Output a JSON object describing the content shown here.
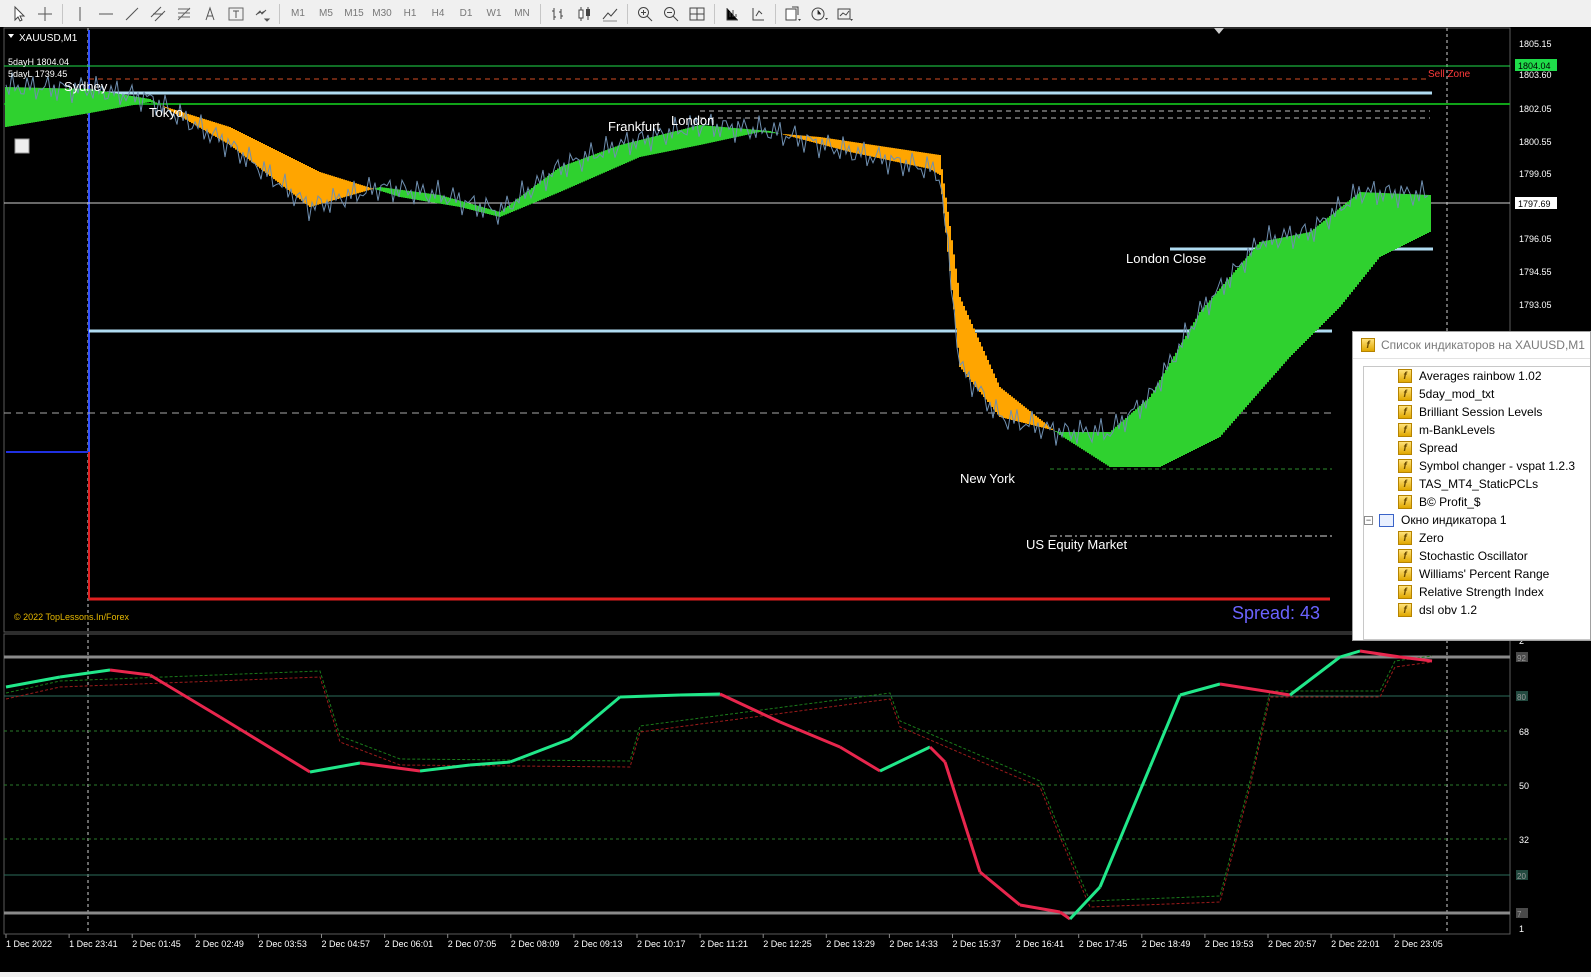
{
  "toolbar": {
    "timeframes": [
      "M1",
      "M5",
      "M15",
      "M30",
      "H1",
      "H4",
      "D1",
      "W1",
      "MN"
    ]
  },
  "chart": {
    "symbol_title": "XAUUSD,M1",
    "day_high": "5dayH 1804.04",
    "day_low": "5dayL 1739.45",
    "sell_zone": "Sell Zone",
    "sessions": [
      {
        "name": "sydney",
        "label": "Sydney"
      },
      {
        "name": "tokyo",
        "label": "Tokyo"
      },
      {
        "name": "frankfurt",
        "label": "Frankfurt"
      },
      {
        "name": "london",
        "label": "London"
      },
      {
        "name": "london-close",
        "label": "London Close"
      },
      {
        "name": "newyork",
        "label": "New York"
      },
      {
        "name": "us-equity",
        "label": "US Equity Market"
      }
    ],
    "copyright": "© 2022 TopLessons.In/Forex",
    "spread": "Spread: 43",
    "price_axis": [
      "1805.15",
      "1803.60",
      "1802.05",
      "1800.55",
      "1799.05",
      "1796.05",
      "1794.55",
      "1793.05"
    ],
    "price_tags": [
      {
        "name": "high-tag",
        "value": "1804.04",
        "color": "#1fdc4a"
      },
      {
        "name": "current-tag",
        "value": "1797.69",
        "color": "#ffffff"
      }
    ],
    "time_axis": [
      "1 Dec 2022",
      "1 Dec 23:41",
      "2 Dec 01:45",
      "2 Dec 02:49",
      "2 Dec 03:53",
      "2 Dec 04:57",
      "2 Dec 06:01",
      "2 Dec 07:05",
      "2 Dec 08:09",
      "2 Dec 09:13",
      "2 Dec 10:17",
      "2 Dec 11:21",
      "2 Dec 12:25",
      "2 Dec 13:29",
      "2 Dec 14:33",
      "2 Dec 15:37",
      "2 Dec 16:41",
      "2 Dec 17:45",
      "2 Dec 18:49",
      "2 Dec 19:53",
      "2 Dec 20:57",
      "2 Dec 22:01",
      "2 Dec 23:05"
    ],
    "sub_axis": [
      "2",
      "68",
      "50",
      "32",
      "1"
    ],
    "sub_level_tags": [
      "80",
      "20",
      "7",
      "92"
    ],
    "colors": {
      "bull": "#2fd12f",
      "bear": "#ffa500",
      "level_line": "#b0dcf2",
      "osc_up": "#21e88a",
      "osc_down": "#e8264d",
      "spread": "#6b63ff"
    }
  },
  "indicators_panel": {
    "title": "Список индикаторов на XAUUSD,M1",
    "items": [
      "Averages rainbow 1.02",
      "5day_mod_txt",
      "Brilliant Session Levels",
      "m-BankLevels",
      "Spread",
      "Symbol changer - vspat 1.2.3",
      "TAS_MT4_StaticPCLs",
      "B© Profit_$"
    ],
    "window_label": "Окно индикатора 1",
    "sub_items": [
      "Zero",
      "Stochastic Oscillator",
      "Williams' Percent Range",
      "Relative Strength Index",
      "dsl obv 1.2"
    ]
  }
}
